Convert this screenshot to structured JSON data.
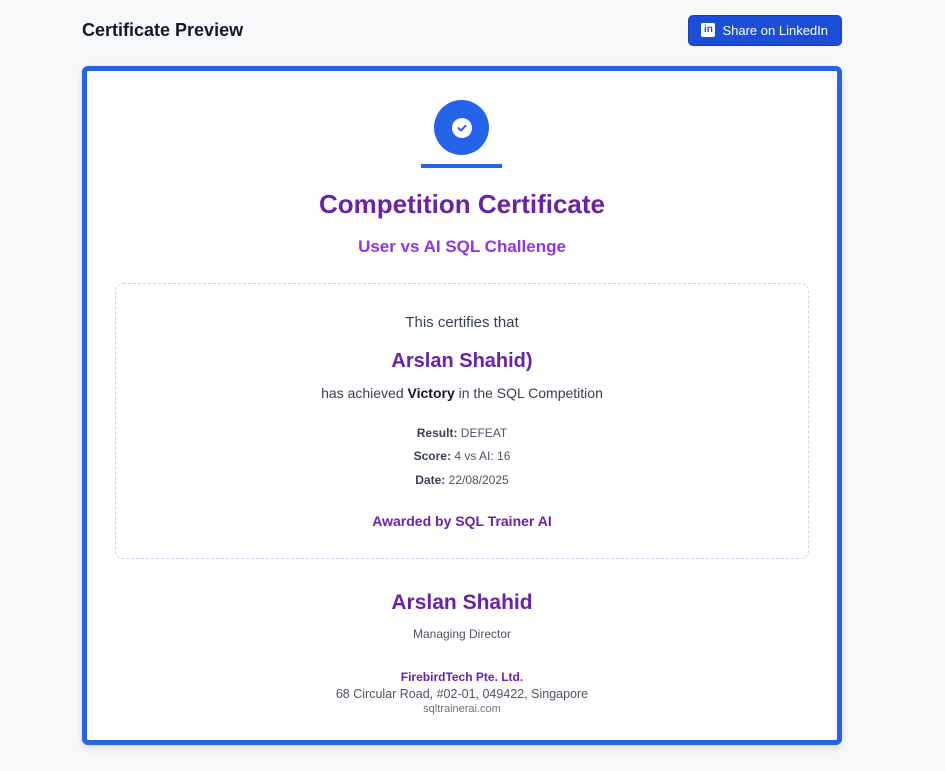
{
  "header": {
    "title": "Certificate Preview",
    "share_label": "Share on LinkedIn",
    "share_icon": "linkedin-icon"
  },
  "certificate": {
    "badge_icon": "check-circle-icon",
    "title": "Competition Certificate",
    "subtitle": "User vs AI SQL Challenge",
    "certifies": "This certifies that",
    "recipient": "Arslan Shahid)",
    "achieved_prefix": "has achieved",
    "achieved_result": "Victory",
    "achieved_suffix": "in the SQL Competition",
    "result_label": "Result:",
    "result_value": "DEFEAT",
    "score_label": "Score:",
    "score_value": "4 vs AI: 16",
    "date_label": "Date:",
    "date_value": "22/08/2025",
    "awarded_by": "Awarded by SQL Trainer AI",
    "signer_name": "Arslan Shahid",
    "signer_title": "Managing Director",
    "company": "FirebirdTech Pte. Ltd.",
    "address": "68 Circular Road, #02-01, 049422, Singapore",
    "website": "sqltrainerai.com"
  },
  "colors": {
    "accent": "#2563eb",
    "title": "#6b21a8",
    "subtitle": "#9333ea"
  }
}
